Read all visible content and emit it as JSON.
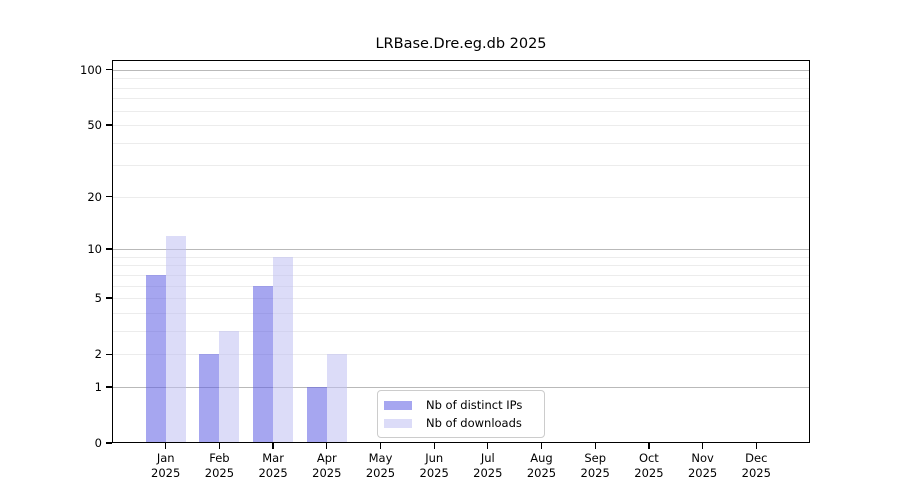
{
  "chart_data": {
    "type": "bar",
    "title": "LRBase.Dre.eg.db 2025",
    "months": [
      "Jan",
      "Feb",
      "Mar",
      "Apr",
      "May",
      "Jun",
      "Jul",
      "Aug",
      "Sep",
      "Oct",
      "Nov",
      "Dec"
    ],
    "year": "2025",
    "yscale": "log1p",
    "ylim": [
      0,
      113
    ],
    "yticks": [
      0,
      1,
      2,
      5,
      10,
      20,
      50,
      100
    ],
    "grid": {
      "major": [
        1,
        10,
        100
      ],
      "minor": [
        2,
        3,
        4,
        5,
        6,
        7,
        8,
        9,
        20,
        30,
        40,
        50,
        60,
        70,
        80,
        90
      ]
    },
    "series": [
      {
        "name": "Nb of distinct IPs",
        "color": "rgba(92,92,228,0.55)",
        "solid_color": "#a5a5f0",
        "values": [
          7,
          2,
          6,
          1,
          0,
          0,
          0,
          0,
          0,
          0,
          0,
          0
        ]
      },
      {
        "name": "Nb of downloads",
        "color": "rgba(191,191,242,0.55)",
        "solid_color": "#dcdcf8",
        "values": [
          12,
          3,
          9,
          2,
          0,
          0,
          0,
          0,
          0,
          0,
          0,
          0
        ]
      }
    ],
    "legend_position": "bottom-center"
  },
  "colors": {
    "background": "#ffffff",
    "spine": "#000000",
    "grid_major": "#b9b9b9",
    "grid_minor": "#ececec",
    "legend_border": "#cccccc",
    "text": "#000000"
  }
}
